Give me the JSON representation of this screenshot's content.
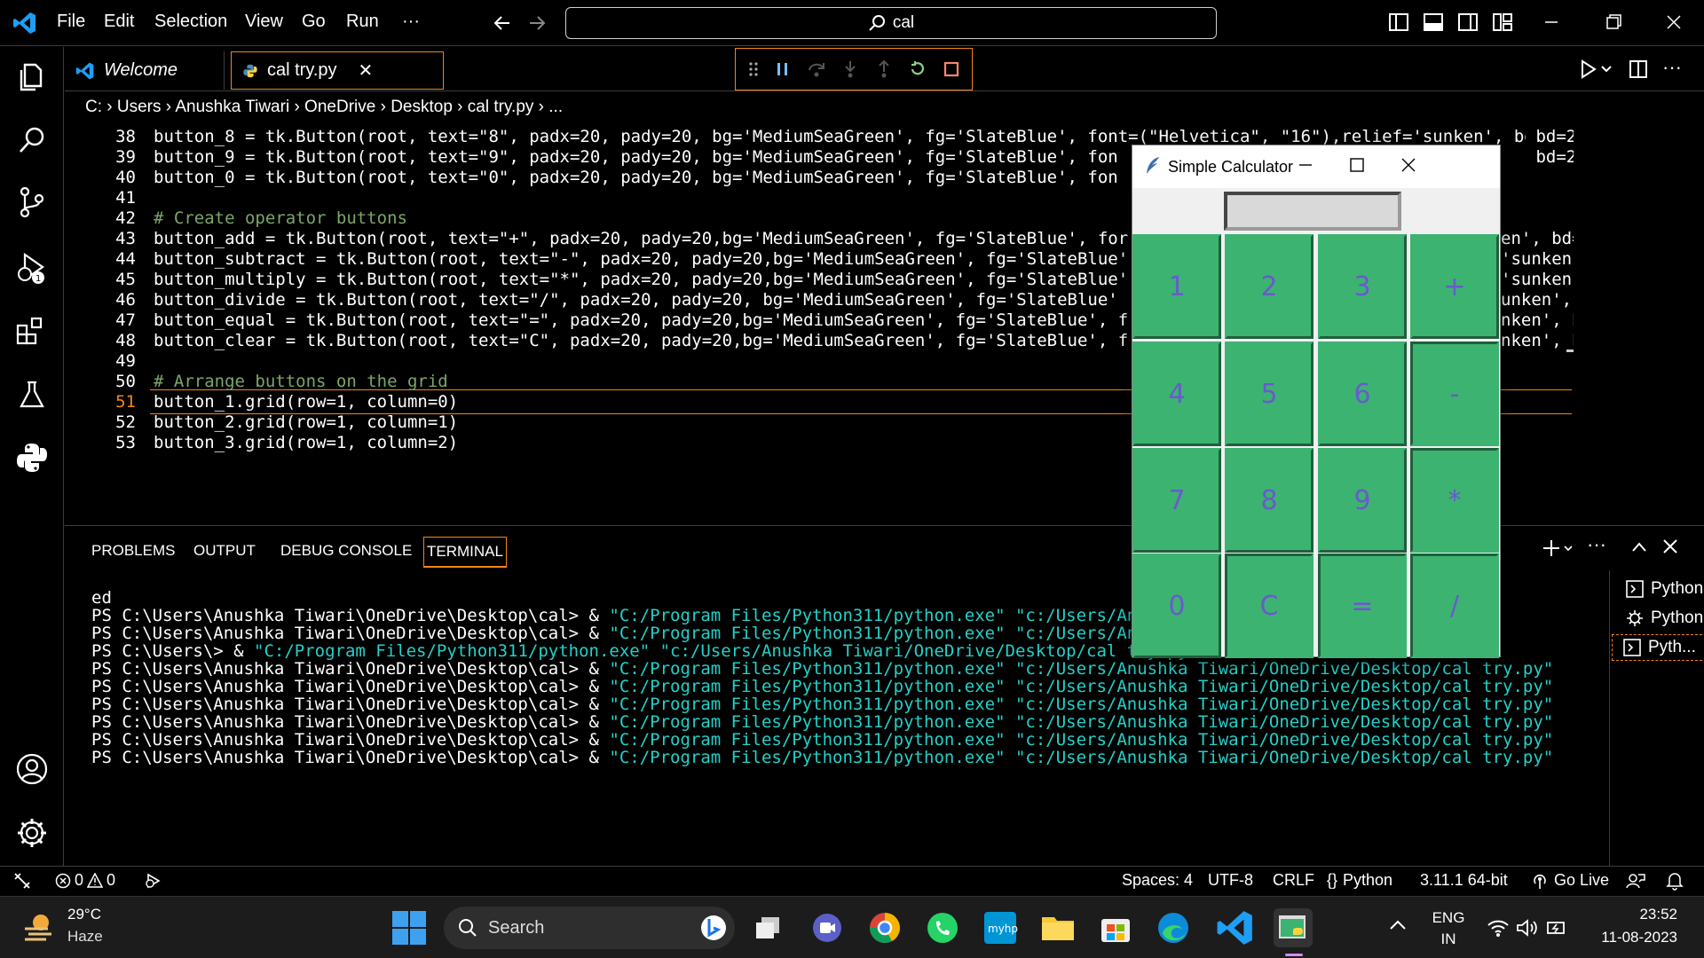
{
  "menu": [
    "File",
    "Edit",
    "Selection",
    "View",
    "Go",
    "Run",
    "···"
  ],
  "search": {
    "text": "cal"
  },
  "tabs": {
    "welcome": "Welcome",
    "active": "cal try.py",
    "close": "✕"
  },
  "breadcrumb": "C: › Users › Anushka Tiwari › OneDrive › Desktop › cal try.py › ...",
  "editor": {
    "line_numbers": [
      "38",
      "39",
      "40",
      "41",
      "42",
      "43",
      "44",
      "45",
      "46",
      "47",
      "48",
      "49",
      "50",
      "51",
      "52",
      "53"
    ],
    "lines": [
      "button_8 = tk.Button(root, text=\"8\", padx=20, pady=20, bg='MediumSeaGreen', fg='SlateBlue', font=(\"Helvetica\", \"16\"),relief='sunken', bd=2,",
      "button_9 = tk.Button(root, text=\"9\", padx=20, pady=20, bg='MediumSeaGreen', fg='SlateBlue', fon",
      "button_0 = tk.Button(root, text=\"0\", padx=20, pady=20, bg='MediumSeaGreen', fg='SlateBlue', fon",
      "",
      "# Create operator buttons",
      "button_add = tk.Button(root, text=\"+\", padx=20, pady=20,bg='MediumSeaGreen', fg='SlateBlue', for",
      "button_subtract = tk.Button(root, text=\"-\", padx=20, pady=20,bg='MediumSeaGreen', fg='SlateBlue'",
      "button_multiply = tk.Button(root, text=\"*\", padx=20, pady=20,bg='MediumSeaGreen', fg='SlateBlue'",
      "button_divide = tk.Button(root, text=\"/\", padx=20, pady=20, bg='MediumSeaGreen', fg='SlateBlue'",
      "button_equal = tk.Button(root, text=\"=\", padx=20, pady=20,bg='MediumSeaGreen', fg='SlateBlue', f",
      "button_clear = tk.Button(root, text=\"C\", padx=20, pady=20,bg='MediumSeaGreen', fg='SlateBlue', f",
      "",
      "# Arrange buttons on the grid",
      "button_1.grid(row=1, column=0)",
      "button_2.grid(row=1, column=1)",
      "button_3.grid(row=1, column=2)"
    ],
    "right_fragments": [
      " bd=2,",
      " bd=2,",
      "en', bd=",
      "'sunken'",
      "'sunken'",
      "unken',",
      "nken', b",
      "nken', b"
    ]
  },
  "panel": {
    "tabs": [
      "PROBLEMS",
      "OUTPUT",
      "DEBUG CONSOLE",
      "TERMINAL"
    ],
    "terminal": [
      {
        "p": "ed",
        "s": ""
      },
      {
        "p": "PS C:\\Users\\Anushka Tiwari\\OneDrive\\Desktop\\cal> & ",
        "s": "\"C:/Program Files/Python311/python.exe\" \"c:/Users/Anushk"
      },
      {
        "p": "PS C:\\Users\\Anushka Tiwari\\OneDrive\\Desktop\\cal> & ",
        "s": "\"C:/Program Files/Python311/python.exe\" \"c:/Users/Anushk"
      },
      {
        "p": "PS C:\\Users\\> & ",
        "s": "\"C:/Program Files/Python311/python.exe\" \"c:/Users/Anushka Tiwari/OneDrive/Desktop/cal try.py\""
      },
      {
        "p": "PS C:\\Users\\Anushka Tiwari\\OneDrive\\Desktop\\cal> & ",
        "s": "\"C:/Program Files/Python311/python.exe\" \"c:/Users/Anushka Tiwari/OneDrive/Desktop/cal try.py\""
      },
      {
        "p": "PS C:\\Users\\Anushka Tiwari\\OneDrive\\Desktop\\cal> & ",
        "s": "\"C:/Program Files/Python311/python.exe\" \"c:/Users/Anushka Tiwari/OneDrive/Desktop/cal try.py\""
      },
      {
        "p": "PS C:\\Users\\Anushka Tiwari\\OneDrive\\Desktop\\cal> & ",
        "s": "\"C:/Program Files/Python311/python.exe\" \"c:/Users/Anushka Tiwari/OneDrive/Desktop/cal try.py\""
      },
      {
        "p": "PS C:\\Users\\Anushka Tiwari\\OneDrive\\Desktop\\cal> & ",
        "s": "\"C:/Program Files/Python311/python.exe\" \"c:/Users/Anushka Tiwari/OneDrive/Desktop/cal try.py\""
      },
      {
        "p": "PS C:\\Users\\Anushka Tiwari\\OneDrive\\Desktop\\cal> & ",
        "s": "\"C:/Program Files/Python311/python.exe\" \"c:/Users/Anushka Tiwari/OneDrive/Desktop/cal try.py\""
      },
      {
        "p": "PS C:\\Users\\Anushka Tiwari\\OneDrive\\Desktop\\cal> & ",
        "s": "\"C:/Program Files/Python311/python.exe\" \"c:/Users/Anushka Tiwari/OneDrive/Desktop/cal try.py\""
      }
    ],
    "terminal_list": [
      "Python",
      "Python Deb...",
      "Pyth..."
    ]
  },
  "status": {
    "errors": "0",
    "warnings": "0",
    "spaces": "Spaces: 4",
    "encoding": "UTF-8",
    "eol": "CRLF",
    "language": "Python",
    "interpreter": "3.11.1 64-bit",
    "golive": "Go Live"
  },
  "calculator": {
    "title": "Simple Calculator",
    "buttons": [
      "1",
      "2",
      "3",
      "+",
      "4",
      "5",
      "6",
      "-",
      "7",
      "8",
      "9",
      "*",
      "0",
      "C",
      "=",
      "/"
    ],
    "button_bg": "#3cb371",
    "button_fg": "#6a5acd"
  },
  "taskbar": {
    "weather_temp": "29°C",
    "weather_desc": "Haze",
    "search": "Search",
    "lang1": "ENG",
    "lang2": "IN",
    "time": "23:52",
    "date": "11-08-2023"
  },
  "colors": {
    "accent": "#007acc",
    "debug_border": "#f38518",
    "terminal_string": "#23d1c8"
  }
}
